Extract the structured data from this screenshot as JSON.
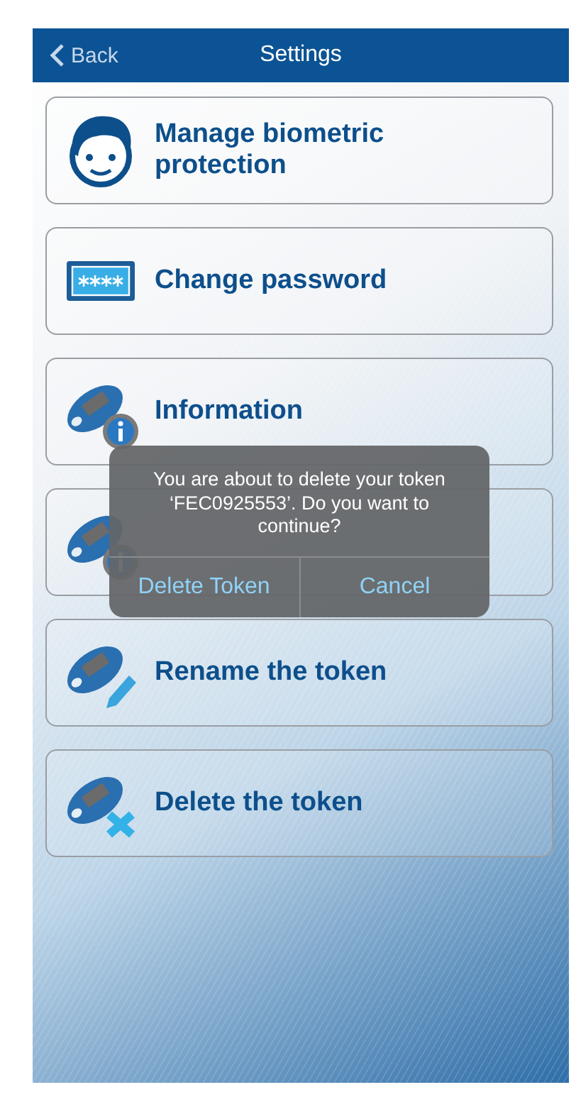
{
  "header": {
    "back": "Back",
    "title": "Settings"
  },
  "items": [
    {
      "kind": "face",
      "label": "Manage biometric protection"
    },
    {
      "kind": "password",
      "label": "Change password"
    },
    {
      "kind": "token-info",
      "label": "Information"
    },
    {
      "kind": "token-info"
    },
    {
      "kind": "token-pen",
      "label": "Rename the token"
    },
    {
      "kind": "token-delete",
      "label": "Delete the token"
    }
  ],
  "dialog": {
    "message": "You are about to delete your token ‘FEC0925553’. Do you want to continue?",
    "buttons": [
      "Delete Token",
      "Cancel"
    ]
  }
}
